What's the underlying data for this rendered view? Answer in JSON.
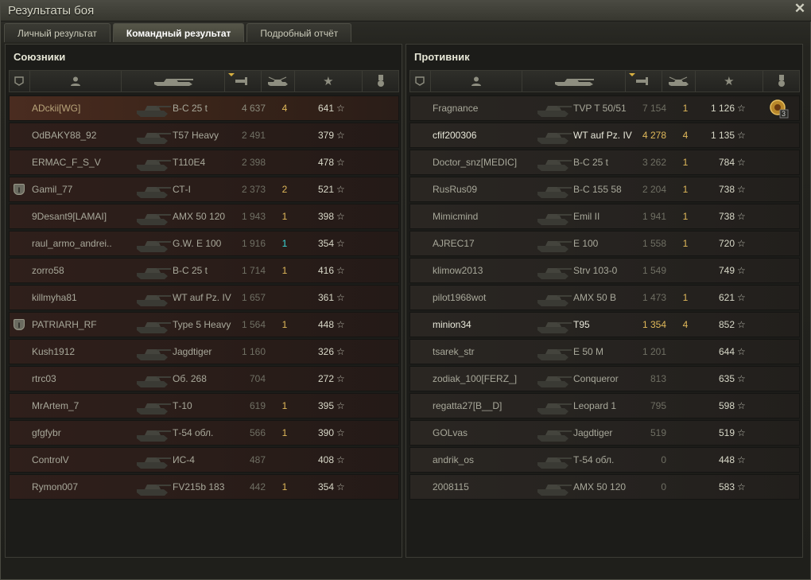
{
  "window": {
    "title": "Результаты боя",
    "close_icon": "close-icon"
  },
  "tabs": [
    {
      "label": "Личный результат",
      "active": false
    },
    {
      "label": "Командный результат",
      "active": true
    },
    {
      "label": "Подробный отчёт",
      "active": false
    }
  ],
  "columns": [
    "rank-icon",
    "player-icon",
    "tank-icon",
    "damage-icon",
    "kills-icon",
    "xp-star-icon",
    "achievement-icon"
  ],
  "allies": {
    "title": "Союзники",
    "rows": [
      {
        "platoon": "",
        "name": "ADckii[WG]",
        "tank": "В-С 25 t",
        "damage": "4 637",
        "kills": "4",
        "xp": "641",
        "me": true
      },
      {
        "platoon": "",
        "name": "OdBAKY88_92",
        "tank": "T57 Heavy",
        "damage": "2 491",
        "kills": "",
        "xp": "379"
      },
      {
        "platoon": "",
        "name": "ERMAC_F_S_V",
        "tank": "T110E4",
        "damage": "2 398",
        "kills": "",
        "xp": "478"
      },
      {
        "platoon": "I",
        "name": "Gamil_77",
        "tank": "СТ-I",
        "damage": "2 373",
        "kills": "2",
        "xp": "521"
      },
      {
        "platoon": "",
        "name": "9Desant9[LAMAI]",
        "tank": "AMX 50 120",
        "damage": "1 943",
        "kills": "1",
        "xp": "398"
      },
      {
        "platoon": "",
        "name": "raul_armo_andrei..",
        "tank": "G.W. E 100",
        "damage": "1 916",
        "kills": "1",
        "xp": "354",
        "kills_cyan": true
      },
      {
        "platoon": "",
        "name": "zorro58",
        "tank": "В-С 25 t",
        "damage": "1 714",
        "kills": "1",
        "xp": "416"
      },
      {
        "platoon": "",
        "name": "killmyha81",
        "tank": "WT auf Pz. IV",
        "damage": "1 657",
        "kills": "",
        "xp": "361"
      },
      {
        "platoon": "I",
        "name": "PATRIARH_RF",
        "tank": "Type 5 Heavy",
        "damage": "1 564",
        "kills": "1",
        "xp": "448"
      },
      {
        "platoon": "",
        "name": "Kush1912",
        "tank": "Jagdtiger",
        "damage": "1 160",
        "kills": "",
        "xp": "326"
      },
      {
        "platoon": "",
        "name": "rtrc03",
        "tank": "Об. 268",
        "damage": "704",
        "kills": "",
        "xp": "272"
      },
      {
        "platoon": "",
        "name": "MrArtem_7",
        "tank": "Т-10",
        "damage": "619",
        "kills": "1",
        "xp": "395"
      },
      {
        "platoon": "",
        "name": "gfgfybr",
        "tank": "Т-54 обл.",
        "damage": "566",
        "kills": "1",
        "xp": "390"
      },
      {
        "platoon": "",
        "name": "ControlV",
        "tank": "ИС-4",
        "damage": "487",
        "kills": "",
        "xp": "408"
      },
      {
        "platoon": "",
        "name": "Rymon007",
        "tank": "FV215b 183",
        "damage": "442",
        "kills": "1",
        "xp": "354"
      }
    ]
  },
  "enemies": {
    "title": "Противник",
    "rows": [
      {
        "name": "Fragnance",
        "tank": "TVP T 50/51",
        "damage": "7 154",
        "kills": "1",
        "xp": "1 126",
        "achievement": "3"
      },
      {
        "name": "cfif200306",
        "tank": "WT auf Pz. IV",
        "damage": "4 278",
        "kills": "4",
        "xp": "1 135",
        "alive": true
      },
      {
        "name": "Doctor_snz[MEDIC]",
        "tank": "В-С 25 t",
        "damage": "3 262",
        "kills": "1",
        "xp": "784"
      },
      {
        "name": "RusRus09",
        "tank": "В-С 155 58",
        "damage": "2 204",
        "kills": "1",
        "xp": "738"
      },
      {
        "name": "Mimicmind",
        "tank": "Emil II",
        "damage": "1 941",
        "kills": "1",
        "xp": "738"
      },
      {
        "name": "AJREC17",
        "tank": "E 100",
        "damage": "1 558",
        "kills": "1",
        "xp": "720"
      },
      {
        "name": "klimow2013",
        "tank": "Strv 103-0",
        "damage": "1 549",
        "kills": "",
        "xp": "749"
      },
      {
        "name": "pilot1968wot",
        "tank": "AMX 50 B",
        "damage": "1 473",
        "kills": "1",
        "xp": "621"
      },
      {
        "name": "minion34",
        "tank": "T95",
        "damage": "1 354",
        "kills": "4",
        "xp": "852",
        "alive": true
      },
      {
        "name": "tsarek_str",
        "tank": "E 50 M",
        "damage": "1 201",
        "kills": "",
        "xp": "644"
      },
      {
        "name": "zodiak_100[FERZ_]",
        "tank": "Conqueror",
        "damage": "813",
        "kills": "",
        "xp": "635"
      },
      {
        "name": "regatta27[B__D]",
        "tank": "Leopard 1",
        "damage": "795",
        "kills": "",
        "xp": "598"
      },
      {
        "name": "GOLvas",
        "tank": "Jagdtiger",
        "damage": "519",
        "kills": "",
        "xp": "519"
      },
      {
        "name": "andrik_os",
        "tank": "Т-54 обл.",
        "damage": "0",
        "kills": "",
        "xp": "448"
      },
      {
        "name": "2008115",
        "tank": "AMX 50 120",
        "damage": "0",
        "kills": "",
        "xp": "583"
      }
    ]
  },
  "star_glyph": "☆",
  "colors": {
    "accent": "#e0b95a",
    "cyan": "#3ad6d6"
  }
}
